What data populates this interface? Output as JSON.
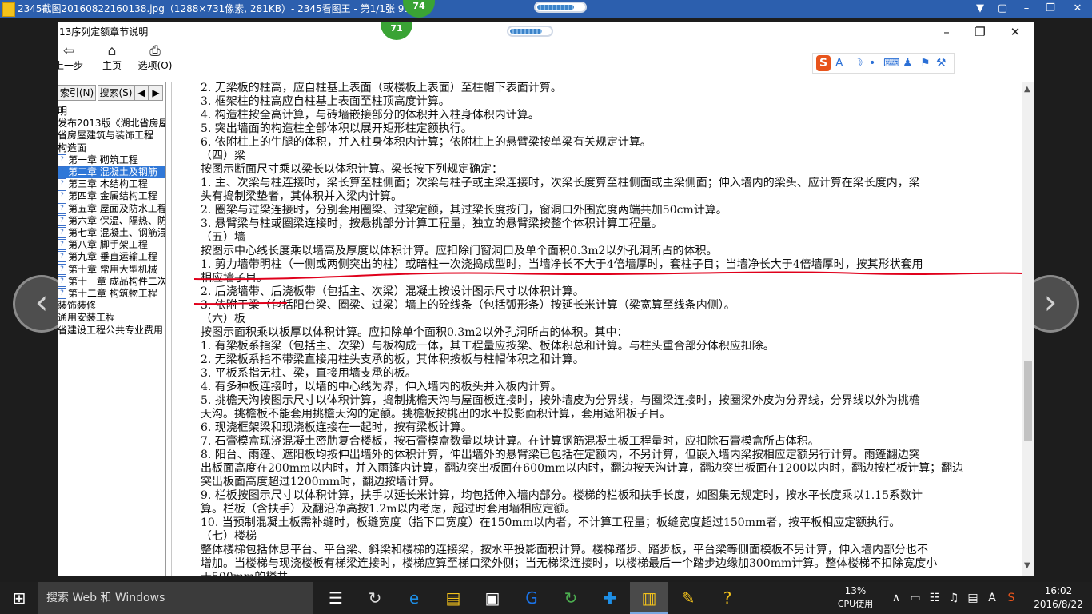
{
  "viewer": {
    "title": "2345截图20160822160138.jpg（1288×731像素, 281KB）- 2345看图王 - 第1/1张 95%",
    "badge_top": "74",
    "badge_inner": "71",
    "progress_pct": 80,
    "controls": [
      "▼",
      "▢",
      "–",
      "❐",
      "✕"
    ]
  },
  "app": {
    "title": "13序列定额章节说明",
    "window_controls": [
      "–",
      "❐",
      "✕"
    ],
    "toolbar": [
      {
        "icon": "⇦",
        "label": "上一步"
      },
      {
        "icon": "⌂",
        "label": "主页"
      },
      {
        "icon": "⎙",
        "label": "选项(O)"
      }
    ],
    "ime_icons": [
      "S",
      "A",
      "☽",
      "•",
      "⌨",
      "♟",
      "⚑",
      "⚒"
    ]
  },
  "sidebar": {
    "tabs": [
      "索引(N)",
      "搜索(S)",
      "◀",
      "▶"
    ],
    "items": [
      {
        "text": "明",
        "q": false,
        "selected": false
      },
      {
        "text": "发布2013版《湖北省房屋",
        "q": false,
        "selected": false
      },
      {
        "text": "省房屋建筑与装饰工程",
        "q": false,
        "selected": false
      },
      {
        "text": "构造面",
        "q": false,
        "selected": false
      },
      {
        "text": "第一章 砌筑工程",
        "q": true,
        "selected": false
      },
      {
        "text": "第二章 混凝土及钢筋",
        "q": true,
        "selected": true
      },
      {
        "text": "第三章 木结构工程",
        "q": true,
        "selected": false
      },
      {
        "text": "第四章 金属结构工程",
        "q": true,
        "selected": false
      },
      {
        "text": "第五章 屋面及防水工程",
        "q": true,
        "selected": false
      },
      {
        "text": "第六章 保温、隔热、防",
        "q": true,
        "selected": false
      },
      {
        "text": "第七章 混凝土、钢筋混",
        "q": true,
        "selected": false
      },
      {
        "text": "第八章 脚手架工程",
        "q": true,
        "selected": false
      },
      {
        "text": "第九章 垂直运输工程",
        "q": true,
        "selected": false
      },
      {
        "text": "第十章 常用大型机械",
        "q": true,
        "selected": false
      },
      {
        "text": "第十一章 成品构件二次",
        "q": true,
        "selected": false
      },
      {
        "text": "第十二章 构筑物工程",
        "q": true,
        "selected": false
      },
      {
        "text": "装饰装修",
        "q": false,
        "selected": false
      },
      {
        "text": "通用安装工程",
        "q": false,
        "selected": false
      },
      {
        "text": "省建设工程公共专业费用",
        "q": false,
        "selected": false
      }
    ]
  },
  "doc_lines": [
    "2. 无梁板的柱高，应自柱基上表面（或楼板上表面）至柱帽下表面计算。",
    "3. 框架柱的柱高应自柱基上表面至柱顶高度计算。",
    "4. 构造柱按全高计算，与砖墙嵌接部分的体积并入柱身体积内计算。",
    "5. 突出墙面的构造柱全部体积以展开矩形柱定额执行。",
    "6. 依附柱上的牛腿的体积，并入柱身体积内计算；依附柱上的悬臂梁按单梁有关规定计算。",
    "（四）梁",
    "按图示断面尺寸乘以梁长以体积计算。梁长按下列规定确定：",
    "1. 主、次梁与柱连接时，梁长算至柱侧面；次梁与柱子或主梁连接时，次梁长度算至柱侧面或主梁侧面；伸入墙内的梁头、应计算在梁长度内，梁",
    "头有捣制梁垫者，其体积并入梁内计算。",
    "2. 圈梁与过梁连接时，分别套用圈梁、过梁定额，其过梁长度按门，窗洞口外围宽度两端共加50cm计算。",
    "3. 悬臂梁与柱或圈梁连接时，按悬挑部分计算工程量，独立的悬臂梁按整个体积计算工程量。",
    "（五）墙",
    "按图示中心线长度乘以墙高及厚度以体积计算。应扣除门窗洞口及单个面积0.3m2以外孔洞所占的体积。",
    "1. 剪力墙带明柱（一侧或两侧突出的柱）或暗柱一次浇捣成型时，当墙净长不大于4倍墙厚时，套柱子目；当墙净长大于4倍墙厚时，按其形状套用",
    "相应墙子目。",
    "2. 后浇墙带、后浇板带（包括主、次梁）混凝土按设计图示尺寸以体积计算。",
    "3. 依附于梁（包括阳台梁、圈梁、过梁）墙上的砼线条（包括弧形条）按延长米计算（梁宽算至线条内侧）。",
    "（六）板",
    "按图示面积乘以板厚以体积计算。应扣除单个面积0.3m2以外孔洞所占的体积。其中：",
    "1. 有梁板系指梁（包括主、次梁）与板构成一体，其工程量应按梁、板体积总和计算。与柱头重合部分体积应扣除。",
    "2. 无梁板系指不带梁直接用柱头支承的板，其体积按板与柱帽体积之和计算。",
    "3. 平板系指无柱、梁，直接用墙支承的板。",
    "4. 有多种板连接时，以墙的中心线为界，伸入墙内的板头并入板内计算。",
    "5. 挑檐天沟按图示尺寸以体积计算，捣制挑檐天沟与屋面板连接时，按外墙皮为分界线，与圈梁连接时，按圈梁外皮为分界线，分界线以外为挑檐",
    "天沟。挑檐板不能套用挑檐天沟的定额。挑檐板按挑出的水平投影面积计算，套用遮阳板子目。",
    "6. 现浇框架梁和现浇板连接在一起时，按有梁板计算。",
    "7. 石膏模盒现浇混凝土密肋复合楼板，按石膏模盒数量以块计算。在计算钢筋混凝土板工程量时，应扣除石膏模盒所占体积。",
    "8. 阳台、雨篷、遮阳板均按伸出墙外的体积计算，伸出墙外的悬臂梁已包括在定额内，不另计算，但嵌入墙内梁按相应定额另行计算。雨篷翻边突",
    "出板面高度在200mm以内时，并入雨篷内计算，翻边突出板面在600mm以内时，翻边按天沟计算，翻边突出板面在1200以内时，翻边按栏板计算；翻边",
    "突出板面高度超过1200mm时，翻边按墙计算。",
    "9. 栏板按图示尺寸以体积计算，扶手以延长米计算，均包括伸入墙内部分。楼梯的栏板和扶手长度，如图集无规定时，按水平长度乘以1.15系数计",
    "算。栏板（含扶手）及翻沿净高按1.2m以内考虑，超过时套用墙相应定额。",
    "10. 当预制混凝土板需补缝时，板缝宽度（指下口宽度）在150mm以内者，不计算工程量；板缝宽度超过150mm者，按平板相应定额执行。",
    "（七）楼梯",
    "整体楼梯包括休息平台、平台梁、斜梁和楼梯的连接梁，按水平投影面积计算。楼梯踏步、踏步板，平台梁等侧面模板不另计算，伸入墙内部分也不",
    "增加。当楼梯与现浇楼板有梯梁连接时，楼梯应算至梯口梁外侧；当无梯梁连接时，以楼梯最后一个踏步边缘加300mm计算。整体楼梯不扣除宽度小",
    "于500mm的楼井。"
  ],
  "taskbar": {
    "start_icon": "⊞",
    "search_text": "搜索 Web 和 Windows",
    "apps": [
      "☰",
      "↻",
      "e",
      "▤",
      "▣",
      "G",
      "↻",
      "✚",
      "▥",
      "✎",
      "?"
    ],
    "cpu_pct": "13%",
    "cpu_label": "CPU使用",
    "tray_icons": [
      "∧",
      "▭",
      "☷",
      "♫",
      "▤",
      "A",
      "S"
    ],
    "time": "16:02",
    "date": "2016/8/22"
  },
  "colors": {
    "viewer_bar": "#2c5fae",
    "selection": "#3078d8",
    "annotation": "#e0001b",
    "badge": "#3aa335"
  }
}
